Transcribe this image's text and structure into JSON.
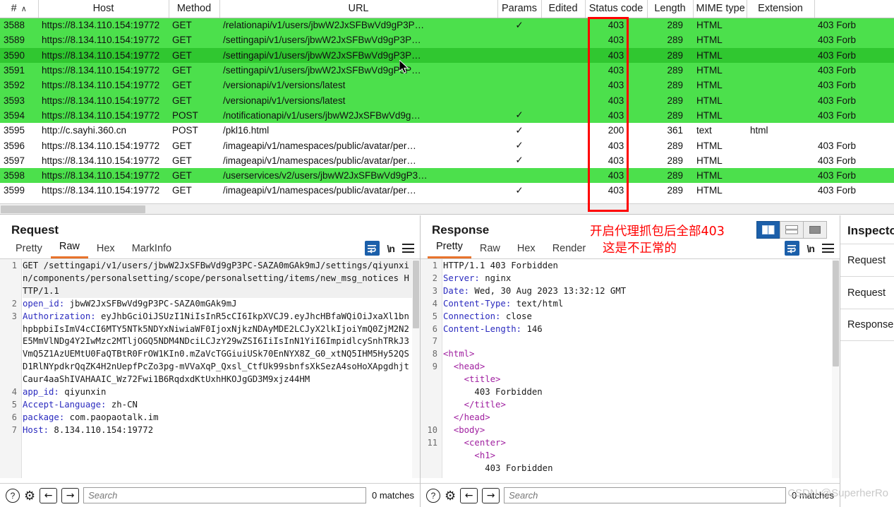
{
  "table": {
    "columns": [
      {
        "key": "num",
        "label": "#",
        "sort": "∧"
      },
      {
        "key": "host",
        "label": "Host"
      },
      {
        "key": "method",
        "label": "Method"
      },
      {
        "key": "url",
        "label": "URL"
      },
      {
        "key": "params",
        "label": "Params"
      },
      {
        "key": "edited",
        "label": "Edited"
      },
      {
        "key": "status",
        "label": "Status code"
      },
      {
        "key": "length",
        "label": "Length"
      },
      {
        "key": "mime",
        "label": "MIME type"
      },
      {
        "key": "extension",
        "label": "Extension"
      },
      {
        "key": "title",
        "label": ""
      }
    ],
    "rows": [
      {
        "num": "3588",
        "host": "https://8.134.110.154:19772",
        "method": "GET",
        "url": "/relationapi/v1/users/jbwW2JxSFBwVd9gP3P…",
        "params": "✓",
        "edited": "",
        "status": "403",
        "length": "289",
        "mime": "HTML",
        "extension": "",
        "title": "403 Forb",
        "state": "green"
      },
      {
        "num": "3589",
        "host": "https://8.134.110.154:19772",
        "method": "GET",
        "url": "/settingapi/v1/users/jbwW2JxSFBwVd9gP3P…",
        "params": "",
        "edited": "",
        "status": "403",
        "length": "289",
        "mime": "HTML",
        "extension": "",
        "title": "403 Forb",
        "state": "green"
      },
      {
        "num": "3590",
        "host": "https://8.134.110.154:19772",
        "method": "GET",
        "url": "/settingapi/v1/users/jbwW2JxSFBwVd9gP3P…",
        "params": "",
        "edited": "",
        "status": "403",
        "length": "289",
        "mime": "HTML",
        "extension": "",
        "title": "403 Forb",
        "state": "selected"
      },
      {
        "num": "3591",
        "host": "https://8.134.110.154:19772",
        "method": "GET",
        "url": "/settingapi/v1/users/jbwW2JxSFBwVd9gP3P…",
        "params": "",
        "edited": "",
        "status": "403",
        "length": "289",
        "mime": "HTML",
        "extension": "",
        "title": "403 Forb",
        "state": "green"
      },
      {
        "num": "3592",
        "host": "https://8.134.110.154:19772",
        "method": "GET",
        "url": "/versionapi/v1/versions/latest",
        "params": "",
        "edited": "",
        "status": "403",
        "length": "289",
        "mime": "HTML",
        "extension": "",
        "title": "403 Forb",
        "state": "green"
      },
      {
        "num": "3593",
        "host": "https://8.134.110.154:19772",
        "method": "GET",
        "url": "/versionapi/v1/versions/latest",
        "params": "",
        "edited": "",
        "status": "403",
        "length": "289",
        "mime": "HTML",
        "extension": "",
        "title": "403 Forb",
        "state": "green"
      },
      {
        "num": "3594",
        "host": "https://8.134.110.154:19772",
        "method": "POST",
        "url": "/notificationapi/v1/users/jbwW2JxSFBwVd9g…",
        "params": "✓",
        "edited": "",
        "status": "403",
        "length": "289",
        "mime": "HTML",
        "extension": "",
        "title": "403 Forb",
        "state": "green"
      },
      {
        "num": "3595",
        "host": "http://c.sayhi.360.cn",
        "method": "POST",
        "url": "/pkl16.html",
        "params": "✓",
        "edited": "",
        "status": "200",
        "length": "361",
        "mime": "text",
        "extension": "html",
        "title": "",
        "state": "white"
      },
      {
        "num": "3596",
        "host": "https://8.134.110.154:19772",
        "method": "GET",
        "url": "/imageapi/v1/namespaces/public/avatar/per…",
        "params": "✓",
        "edited": "",
        "status": "403",
        "length": "289",
        "mime": "HTML",
        "extension": "",
        "title": "403 Forb",
        "state": "white"
      },
      {
        "num": "3597",
        "host": "https://8.134.110.154:19772",
        "method": "GET",
        "url": "/imageapi/v1/namespaces/public/avatar/per…",
        "params": "✓",
        "edited": "",
        "status": "403",
        "length": "289",
        "mime": "HTML",
        "extension": "",
        "title": "403 Forb",
        "state": "white"
      },
      {
        "num": "3598",
        "host": "https://8.134.110.154:19772",
        "method": "GET",
        "url": "/userservices/v2/users/jbwW2JxSFBwVd9gP3…",
        "params": "",
        "edited": "",
        "status": "403",
        "length": "289",
        "mime": "HTML",
        "extension": "",
        "title": "403 Forb",
        "state": "green"
      },
      {
        "num": "3599",
        "host": "https://8.134.110.154:19772",
        "method": "GET",
        "url": "/imageapi/v1/namespaces/public/avatar/per…",
        "params": "✓",
        "edited": "",
        "status": "403",
        "length": "289",
        "mime": "HTML",
        "extension": "",
        "title": "403 Forb",
        "state": "white"
      }
    ]
  },
  "request": {
    "title": "Request",
    "tabs": [
      {
        "label": "Pretty",
        "active": false
      },
      {
        "label": "Raw",
        "active": true
      },
      {
        "label": "Hex",
        "active": false
      },
      {
        "label": "MarkInfo",
        "active": false
      }
    ],
    "lines": [
      {
        "n": "1",
        "text": "GET /settingapi/v1/users/jbwW2JxSFBwVd9gP3PC-SAZA0mGAk9mJ/settings/qiyunxin/components/personalsetting/scope/personalsetting/items/new_msg_notices HTTP/1.1"
      },
      {
        "n": "2",
        "key": "open_id",
        "val": " jbwW2JxSFBwVd9gP3PC-SAZA0mGAk9mJ"
      },
      {
        "n": "3",
        "key": "Authorization",
        "val": " eyJhbGciOiJSUzI1NiIsInR5cCI6IkpXVCJ9.eyJhcHBfaWQiOiJxaXl1bnhpbpbiIsImV4cCI6MTY5NTk5NDYxNiwiaWF0IjoxNjkzNDAyMDE2LCJyX2lkIjoiYmQ0ZjM2N2E5MmVlNDg4Y2IwMzc2MTljOGQ5NDM4NDciLCJzY29wZSI6IiIsInN1YiI6ImpidlcySnhTRkJ3VmQ5Z1AzUEMtU0FaQTBtR0FrOW1KIn0.mZaVcTGGiuiUSk70EnNYX8Z_G0_xtNQ5IHM5Hy52QSD1RlNYpdkrQqZK4H2nUepfPcZo3pg-mVVaXqP_Qxsl_CtfUk99sbnfsXkSezA4soHoXApgdhjtCaur4aaShIVAHAAIC_Wz72Fwi1B6RqdxdKtUxhHKOJgGD3M9xjz44HM"
      },
      {
        "n": "4",
        "key": "app_id",
        "val": " qiyunxin"
      },
      {
        "n": "5",
        "key": "Accept-Language",
        "val": " zh-CN"
      },
      {
        "n": "6",
        "key": "package",
        "val": " com.paopaotalk.im"
      },
      {
        "n": "7",
        "key": "Host",
        "val": " 8.134.110.154:19772"
      }
    ],
    "search_placeholder": "Search",
    "matches": "0 matches"
  },
  "response": {
    "title": "Response",
    "tabs": [
      {
        "label": "Pretty",
        "active": true
      },
      {
        "label": "Raw",
        "active": false
      },
      {
        "label": "Hex",
        "active": false
      },
      {
        "label": "Render",
        "active": false
      }
    ],
    "lines": [
      {
        "n": "1",
        "text": "HTTP/1.1 403 Forbidden"
      },
      {
        "n": "2",
        "key": "Server",
        "val": " nginx"
      },
      {
        "n": "3",
        "key": "Date",
        "val": " Wed, 30 Aug 2023 13:32:12 GMT"
      },
      {
        "n": "4",
        "key": "Content-Type",
        "val": " text/html"
      },
      {
        "n": "5",
        "key": "Connection",
        "val": " close"
      },
      {
        "n": "6",
        "key": "Content-Length",
        "val": " 146"
      },
      {
        "n": "7",
        "text": ""
      },
      {
        "n": "8",
        "tag": "<html>",
        "indent": 0
      },
      {
        "n": "9",
        "tag": "<head>",
        "indent": 1
      },
      {
        "n": "",
        "tag": "<title>",
        "indent": 2
      },
      {
        "n": "",
        "plain": "403 Forbidden",
        "indent": 3
      },
      {
        "n": "",
        "tag": "</title>",
        "indent": 2
      },
      {
        "n": "",
        "tag": "</head>",
        "indent": 1
      },
      {
        "n": "10",
        "tag": "<body>",
        "indent": 1
      },
      {
        "n": "11",
        "tag": "<center>",
        "indent": 2
      },
      {
        "n": "",
        "tag": "<h1>",
        "indent": 3
      },
      {
        "n": "",
        "plain": "403 Forbidden",
        "indent": 4
      }
    ],
    "search_placeholder": "Search",
    "matches": "0 matches"
  },
  "inspector": {
    "title": "Inspector",
    "rows": [
      {
        "label": "Request"
      },
      {
        "label": "Request"
      },
      {
        "label": "Response"
      }
    ]
  },
  "annotation": {
    "line1": "开启代理抓包后全部403",
    "line2": "这是不正常的",
    "color": "#ff0000"
  },
  "watermark": "CSDN @SuperherRo",
  "colors": {
    "row_green": "#4ce04c",
    "row_selected_green": "#30c730",
    "row_white": "#ffffff",
    "highlight_box": "#ff0000",
    "tab_active_underline": "#e8732c",
    "toolbar_blue": "#1b5faa"
  }
}
